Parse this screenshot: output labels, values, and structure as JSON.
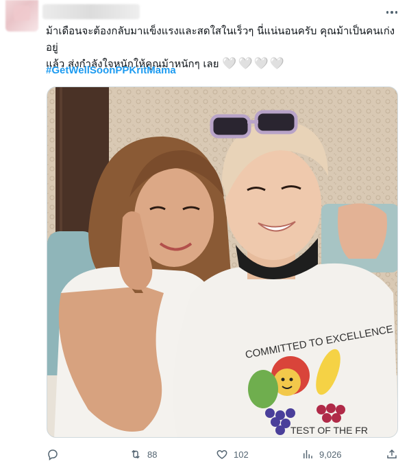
{
  "tweet": {
    "text_line1": "ม้าเดือนจะต้องกลับมาแข็งแรงและสดใสในเร็วๆ นี่แน่นอนครับ คุณม้าเป็นคนเก่งอยู่",
    "text_line2": "แล้ว ส่งกำลังใจหนักให้คุณม้าหนักๆ เลย",
    "hearts": "🤍🤍🤍🤍",
    "hashtag": "#GetWellSoonPPKritMama",
    "shirt_text": "COMMITTED TO EXCELLENCE",
    "shirt_bottom_text": "TEST OF THE FR"
  },
  "actions": {
    "reply_count": "",
    "retweet_count": "88",
    "like_count": "102",
    "views_count": "9,026"
  },
  "icons": {
    "more": "more-horizontal-icon",
    "reply": "reply-bubble-icon",
    "retweet": "retweet-icon",
    "like": "heart-icon",
    "views": "bar-chart-icon",
    "share": "share-upload-icon"
  },
  "colors": {
    "link": "#1d9bf0",
    "secondary_text": "#536471",
    "primary_text": "#0f1419",
    "border": "#cfd9de"
  }
}
